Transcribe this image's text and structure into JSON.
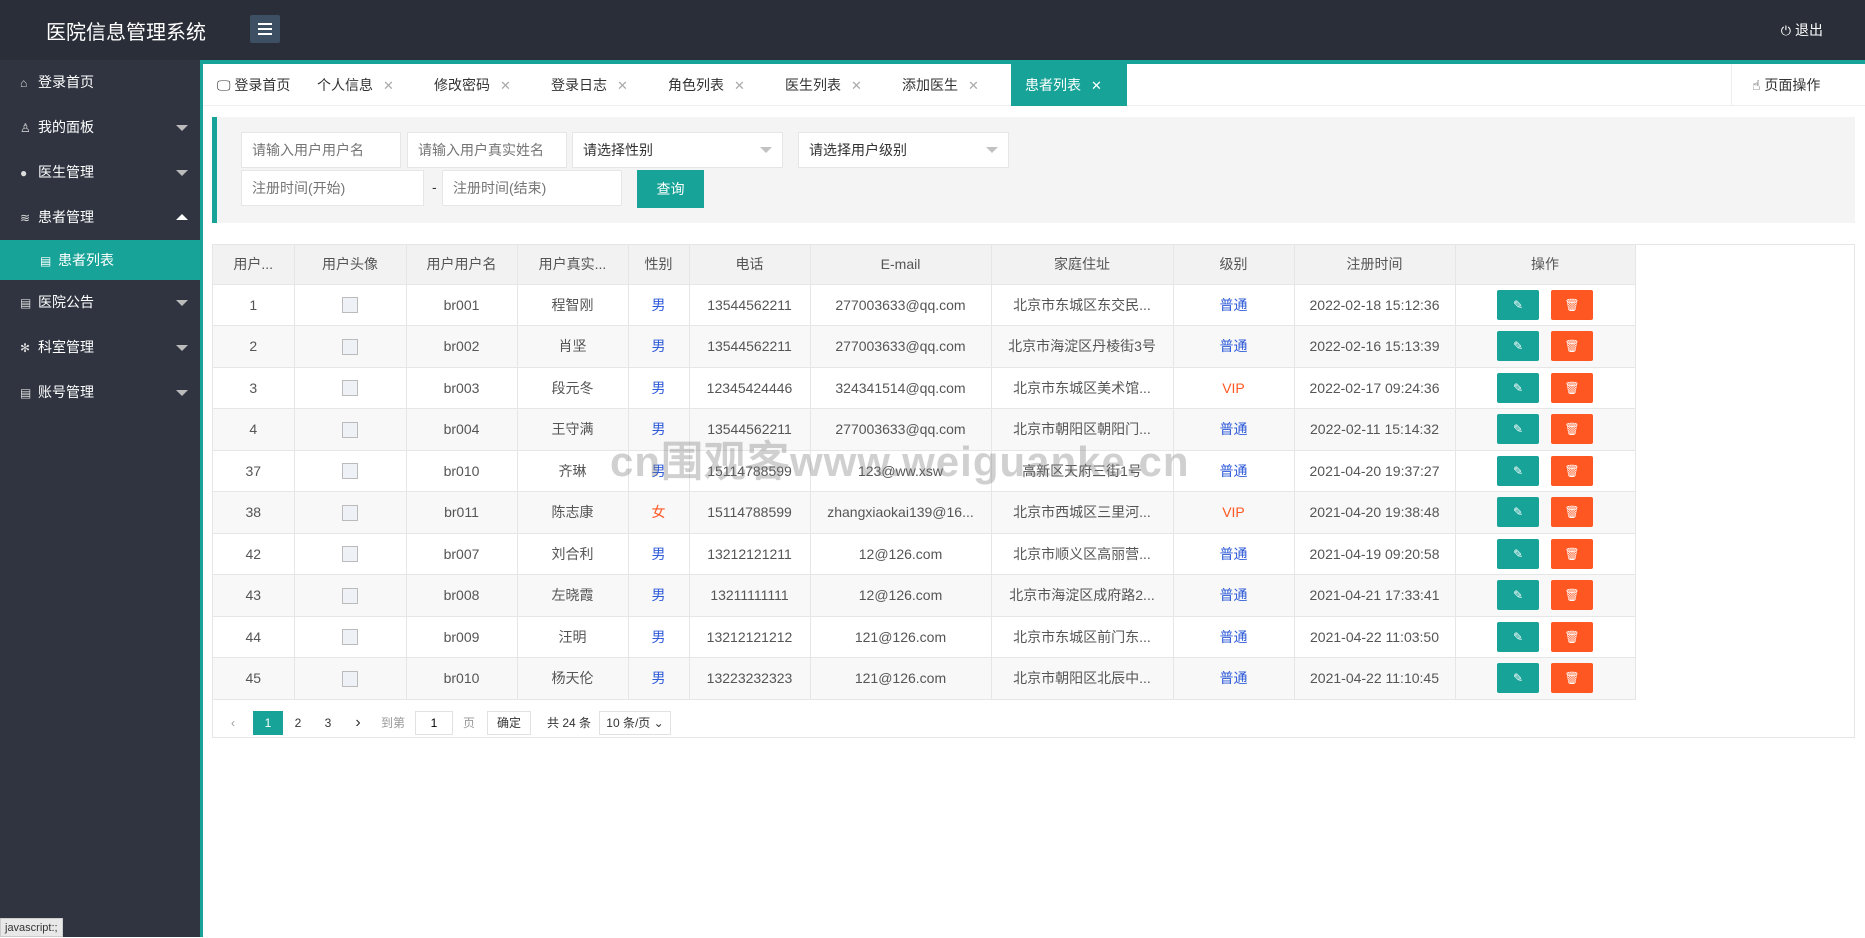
{
  "header": {
    "title": "医院信息管理系统",
    "logout_label": "退出"
  },
  "sidebar": {
    "items": [
      {
        "label": "登录首页",
        "icon": "home-icon"
      },
      {
        "label": "我的面板",
        "icon": "user-icon"
      },
      {
        "label": "医生管理",
        "icon": "chat-icon"
      },
      {
        "label": "患者管理",
        "icon": "layers-icon"
      },
      {
        "label": "医院公告",
        "icon": "doc-icon"
      },
      {
        "label": "科室管理",
        "icon": "snowflake-icon"
      },
      {
        "label": "账号管理",
        "icon": "doc-icon"
      }
    ],
    "sub_item": "患者列表"
  },
  "tabs": [
    {
      "label": "登录首页"
    },
    {
      "label": "个人信息"
    },
    {
      "label": "修改密码"
    },
    {
      "label": "登录日志"
    },
    {
      "label": "角色列表"
    },
    {
      "label": "医生列表"
    },
    {
      "label": "添加医生"
    },
    {
      "label": "患者列表"
    }
  ],
  "page_ops_label": "页面操作",
  "search": {
    "username_placeholder": "请输入用户用户名",
    "realname_placeholder": "请输入用户真实姓名",
    "gender_select": "请选择性别",
    "level_select": "请选择用户级别",
    "start_placeholder": "注册时间(开始)",
    "end_placeholder": "注册时间(结束)",
    "dash": "-",
    "query_label": "查询"
  },
  "table": {
    "headers": [
      "用户...",
      "用户头像",
      "用户用户名",
      "用户真实...",
      "性别",
      "电话",
      "E-mail",
      "家庭住址",
      "级别",
      "注册时间",
      "操作"
    ],
    "rows": [
      {
        "id": "1",
        "username": "br001",
        "realname": "程智刚",
        "gender": "男",
        "phone": "13544562211",
        "email": "277003633@qq.com",
        "address": "北京市东城区东交民...",
        "level": "普通",
        "time": "2022-02-18 15:12:36"
      },
      {
        "id": "2",
        "username": "br002",
        "realname": "肖坚",
        "gender": "男",
        "phone": "13544562211",
        "email": "277003633@qq.com",
        "address": "北京市海淀区丹棱街3号",
        "level": "普通",
        "time": "2022-02-16 15:13:39"
      },
      {
        "id": "3",
        "username": "br003",
        "realname": "段元冬",
        "gender": "男",
        "phone": "12345424446",
        "email": "324341514@qq.com",
        "address": "北京市东城区美术馆...",
        "level": "VIP",
        "time": "2022-02-17 09:24:36"
      },
      {
        "id": "4",
        "username": "br004",
        "realname": "王守满",
        "gender": "男",
        "phone": "13544562211",
        "email": "277003633@qq.com",
        "address": "北京市朝阳区朝阳门...",
        "level": "普通",
        "time": "2022-02-11 15:14:32"
      },
      {
        "id": "37",
        "username": "br010",
        "realname": "齐琳",
        "gender": "男",
        "phone": "15114788599",
        "email": "123@ww.xsw",
        "address": "高新区天府三街1号",
        "level": "普通",
        "time": "2021-04-20 19:37:27"
      },
      {
        "id": "38",
        "username": "br011",
        "realname": "陈志康",
        "gender": "女",
        "phone": "15114788599",
        "email": "zhangxiaokai139@16...",
        "address": "北京市西城区三里河...",
        "level": "VIP",
        "time": "2021-04-20 19:38:48"
      },
      {
        "id": "42",
        "username": "br007",
        "realname": "刘合利",
        "gender": "男",
        "phone": "13212121211",
        "email": "12@126.com",
        "address": "北京市顺义区高丽营...",
        "level": "普通",
        "time": "2021-04-19 09:20:58"
      },
      {
        "id": "43",
        "username": "br008",
        "realname": "左晓霞",
        "gender": "男",
        "phone": "13211111111",
        "email": "12@126.com",
        "address": "北京市海淀区成府路2...",
        "level": "普通",
        "time": "2021-04-21 17:33:41"
      },
      {
        "id": "44",
        "username": "br009",
        "realname": "汪明",
        "gender": "男",
        "phone": "13212121212",
        "email": "121@126.com",
        "address": "北京市东城区前门东...",
        "level": "普通",
        "time": "2021-04-22 11:03:50"
      },
      {
        "id": "45",
        "username": "br010",
        "realname": "杨天伦",
        "gender": "男",
        "phone": "13223232323",
        "email": "121@126.com",
        "address": "北京市朝阳区北辰中...",
        "level": "普通",
        "time": "2021-04-22 11:10:45"
      }
    ]
  },
  "pagination": {
    "pages": [
      "1",
      "2",
      "3"
    ],
    "current": "1",
    "goto_label": "到第",
    "goto_value": "1",
    "page_unit": "页",
    "confirm_label": "确定",
    "total_label": "共 24 条",
    "page_size": "10 条/页"
  },
  "watermark": "cn围观客www.weiguanke.cn",
  "status_bar": "javascript:;",
  "colors": {
    "accent": "#17a398",
    "danger": "#ff5722",
    "header_bg": "#2a2e38",
    "sidebar_bg": "#2f3440",
    "link_blue": "#2e5bd8"
  }
}
